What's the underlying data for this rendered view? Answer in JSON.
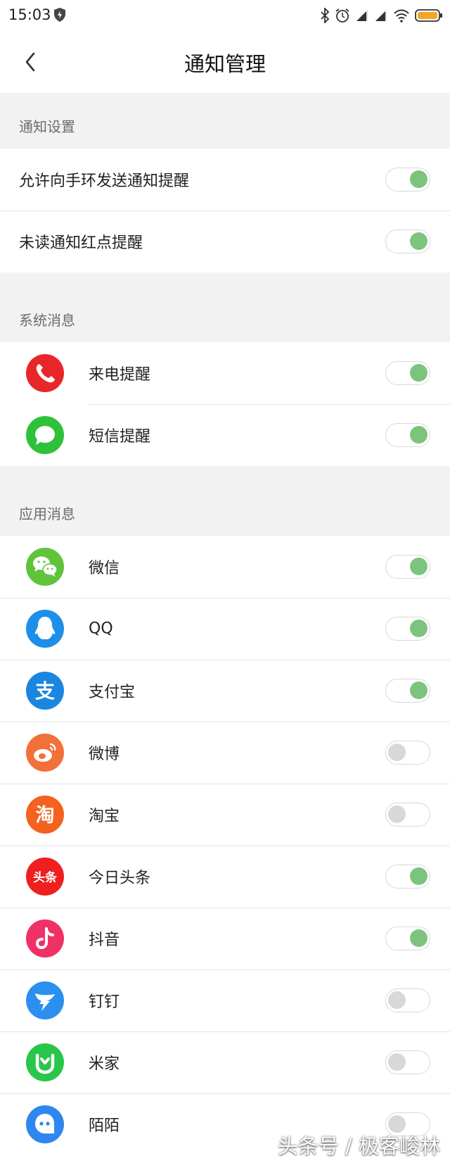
{
  "status_bar": {
    "time": "15:03",
    "icons": [
      "shield-icon",
      "bluetooth-icon",
      "alarm-icon",
      "signal-icon",
      "signal-icon",
      "wifi-icon",
      "battery-icon"
    ],
    "battery_color": "#f5a623"
  },
  "header": {
    "title": "通知管理"
  },
  "sections": {
    "notify_settings": {
      "label": "通知设置",
      "items": [
        {
          "label": "允许向手环发送通知提醒",
          "enabled": true
        },
        {
          "label": "未读通知红点提醒",
          "enabled": true
        }
      ]
    },
    "system": {
      "label": "系统消息",
      "items": [
        {
          "label": "来电提醒",
          "icon": "phone-icon",
          "enabled": true
        },
        {
          "label": "短信提醒",
          "icon": "message-icon",
          "enabled": true
        }
      ]
    },
    "apps": {
      "label": "应用消息",
      "items": [
        {
          "label": "微信",
          "icon": "wechat-icon",
          "enabled": true
        },
        {
          "label": "QQ",
          "icon": "qq-icon",
          "enabled": true
        },
        {
          "label": "支付宝",
          "icon": "alipay-icon",
          "enabled": true
        },
        {
          "label": "微博",
          "icon": "weibo-icon",
          "enabled": false
        },
        {
          "label": "淘宝",
          "icon": "taobao-icon",
          "enabled": false
        },
        {
          "label": "今日头条",
          "icon": "toutiao-icon",
          "enabled": true
        },
        {
          "label": "抖音",
          "icon": "douyin-icon",
          "enabled": true
        },
        {
          "label": "钉钉",
          "icon": "dingtalk-icon",
          "enabled": false
        },
        {
          "label": "米家",
          "icon": "mijia-icon",
          "enabled": false
        },
        {
          "label": "陌陌",
          "icon": "momo-icon",
          "enabled": false
        }
      ]
    }
  },
  "icon_text": {
    "alipay": "支",
    "taobao": "淘",
    "toutiao": "头条"
  },
  "colors": {
    "toggle_on": "#7cc47e",
    "toggle_off": "#d8d8d8",
    "section_bg": "#f2f2f2",
    "phone": "#e8262a",
    "message": "#2ec23a",
    "wechat": "#5fc43a",
    "qq": "#1d8fe8",
    "alipay": "#1a86e0",
    "weibo": "#f2703a",
    "taobao": "#f5611e",
    "toutiao": "#ef1f1f",
    "douyin": "#ef3166",
    "dingtalk": "#2b8ff0",
    "mijia": "#28c64a",
    "momo": "#2f86ee"
  },
  "watermark": "头条号 / 极客峻林"
}
